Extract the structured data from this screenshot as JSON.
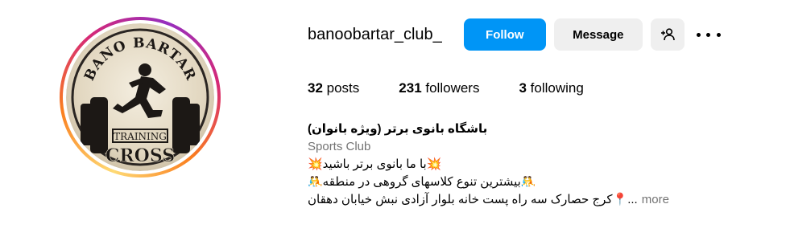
{
  "profile": {
    "username": "banoobartar_club_",
    "avatar_text": {
      "top": "BANO BARTAR",
      "middle": "TRAINING",
      "bottom": "CROSS"
    },
    "colors": {
      "follow_blue": "#0095f6",
      "button_gray": "#efefef",
      "muted_text": "#737373"
    }
  },
  "actions": {
    "follow_label": "Follow",
    "message_label": "Message",
    "add_user_icon": "person-add-icon",
    "more_icon": "more-options-icon"
  },
  "stats": {
    "posts_count": "32",
    "posts_label": " posts",
    "followers_count": "231",
    "followers_label": " followers",
    "following_count": "3",
    "following_label": " following"
  },
  "bio": {
    "name": "باشگاه بانوی برتر (ویژه بانوان)",
    "category": "Sports Club",
    "line1": "💥با ما بانوی برتر باشید💥",
    "line2": "🤼بیشترین تنوع کلاسهای گروهی در منطقه🤼",
    "line3": "📍کرج حصارک سه راه پست خانه بلوار آزادی نبش خیابان دهقان",
    "ellipsis": "...",
    "more_label": "more"
  }
}
